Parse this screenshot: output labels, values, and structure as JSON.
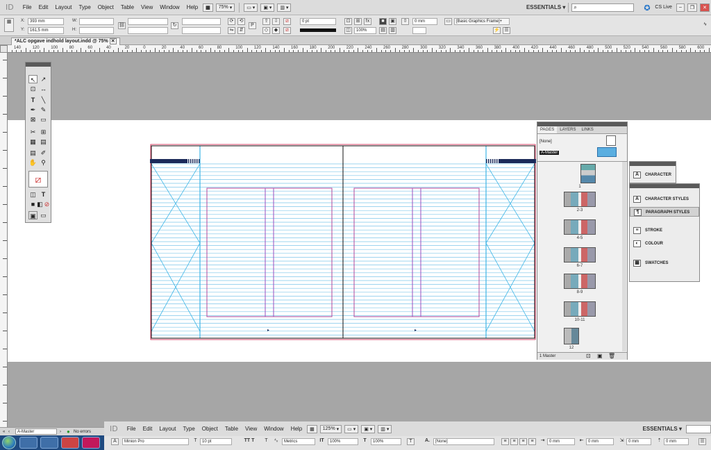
{
  "app": {
    "logo": "ID"
  },
  "menubar": {
    "items": [
      "File",
      "Edit",
      "Layout",
      "Type",
      "Object",
      "Table",
      "View",
      "Window",
      "Help"
    ],
    "zoom": "75%",
    "workspace": "ESSENTIALS",
    "search_placeholder": "",
    "cs_live": "CS Live"
  },
  "controlbar": {
    "x_label": "X:",
    "x_value": "393 mm",
    "y_label": "Y:",
    "y_value": "161,5 mm",
    "w_label": "W:",
    "h_label": "H:",
    "stroke_weight": "0 pt",
    "scale": "100%",
    "gap": "0 mm",
    "frame_style": "[Basic Graphics Frame]+"
  },
  "document": {
    "tab_title": "*ALC opgave indhold layout.indd @ 75%"
  },
  "ruler": {
    "labels": [
      "140",
      "120",
      "100",
      "80",
      "60",
      "40",
      "20",
      "0",
      "20",
      "40",
      "60",
      "80",
      "100",
      "120",
      "140",
      "160",
      "180",
      "200",
      "220",
      "240",
      "260",
      "280",
      "300",
      "320",
      "340",
      "360",
      "380",
      "400",
      "420",
      "440",
      "460",
      "480",
      "500",
      "520",
      "540",
      "560",
      "580",
      "600"
    ]
  },
  "pages_panel": {
    "tabs": [
      "PAGES",
      "LAYERS",
      "LINKS"
    ],
    "masters": [
      "[None]",
      "A-Master"
    ],
    "page_labels": [
      "1",
      "2-3",
      "4-5",
      "6-7",
      "8-9",
      "10-11",
      "12"
    ],
    "footer": "1 Master"
  },
  "char_panel": {
    "items": [
      {
        "label": "CHARACTER",
        "icon": "A"
      }
    ]
  },
  "styles_panel": {
    "items": [
      {
        "label": "CHARACTER STYLES",
        "icon": "A"
      },
      {
        "label": "PARAGRAPH STYLES",
        "icon": "¶"
      },
      {
        "label": "STROKE",
        "icon": "≡"
      },
      {
        "label": "COLOUR",
        "icon": "◐"
      },
      {
        "label": "SWATCHES",
        "icon": "▦"
      }
    ]
  },
  "status": {
    "master": "A-Master",
    "errors": "No errors"
  },
  "bottom": {
    "menu_items": [
      "File",
      "Edit",
      "Layout",
      "Type",
      "Object",
      "Table",
      "View",
      "Window",
      "Help"
    ],
    "zoom": "125%",
    "workspace": "ESSENTIALS",
    "font": "Minion Pro",
    "size": "10 pt",
    "kerning": "Metrics",
    "vscale": "100%",
    "hscale": "100%",
    "char_style": "[None]",
    "indent1": "0 mm",
    "indent2": "0 mm",
    "indent3": "0 mm",
    "indent4": "0 mm"
  },
  "colors": {
    "margin": "#d8456a",
    "column": "#9a4fbf",
    "guide": "#3fb6e6",
    "baseline": "#7ec6ea",
    "page_border": "#111111"
  }
}
